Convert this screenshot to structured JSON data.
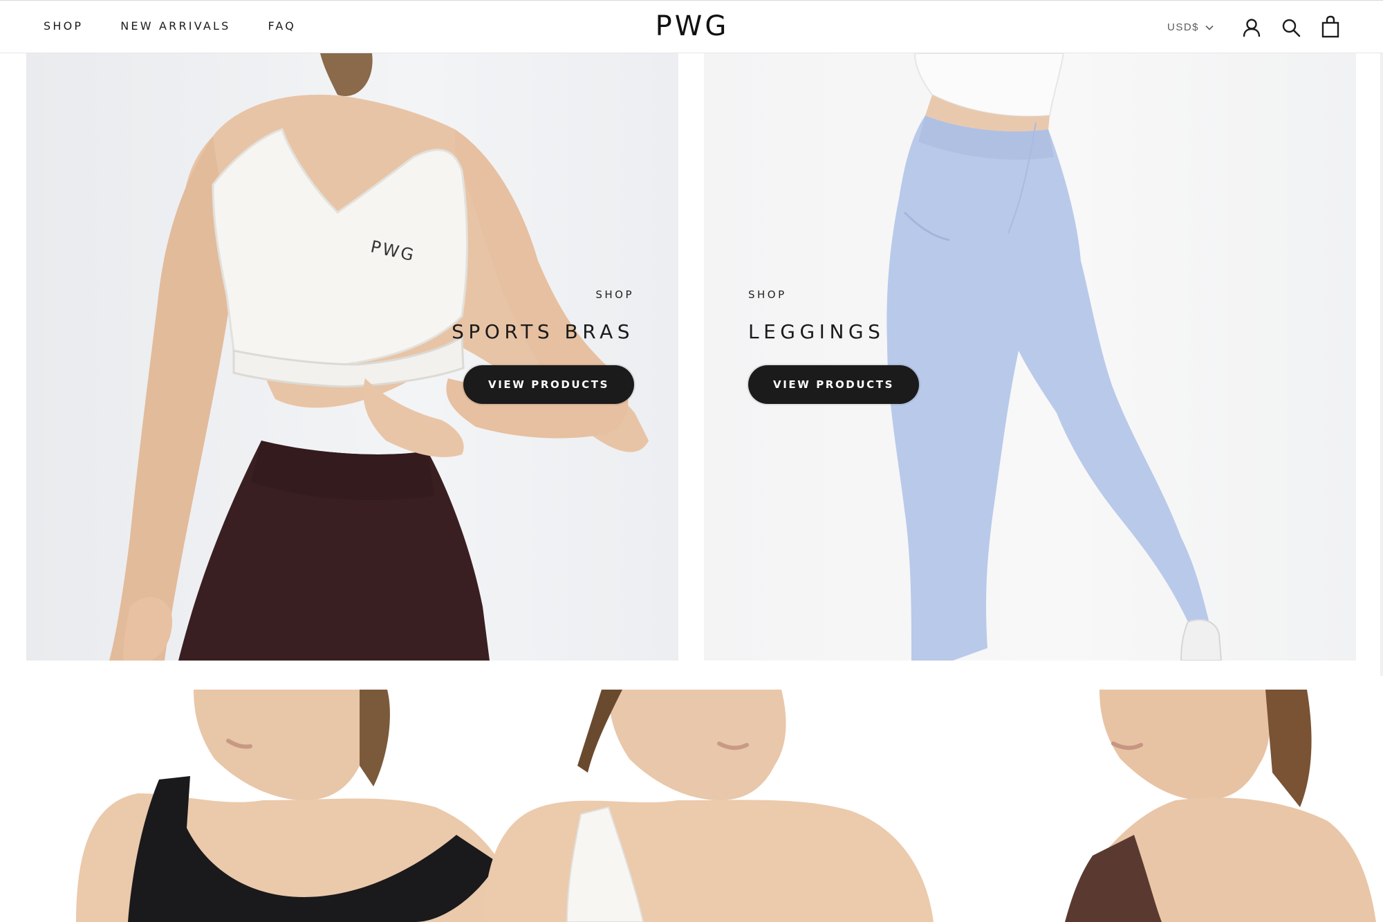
{
  "header": {
    "nav": [
      "SHOP",
      "NEW ARRIVALS",
      "FAQ"
    ],
    "logo_text": "PWG",
    "currency": "USD$"
  },
  "collections": [
    {
      "kicker": "SHOP",
      "title": "SPORTS BRAS",
      "button": "VIEW PRODUCTS",
      "bra_print": "PWG"
    },
    {
      "kicker": "SHOP",
      "title": "LEGGINGS",
      "button": "VIEW PRODUCTS"
    }
  ],
  "icons": {
    "account": "user-icon",
    "search": "search-icon",
    "cart": "shopping-bag-icon",
    "currency_toggle": "chevron-down-icon"
  },
  "colors": {
    "button_bg": "#1c1b1b",
    "button_text": "#ffffff",
    "text": "#1c1b1b",
    "leggings": "#b9c9ea",
    "shorts": "#3a1f22"
  }
}
